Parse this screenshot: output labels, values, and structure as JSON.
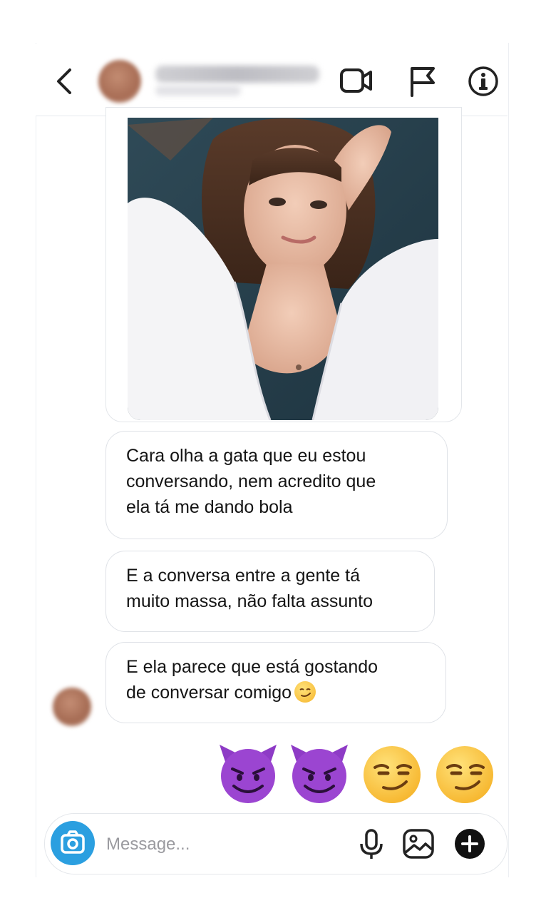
{
  "header": {
    "contact_name": "",
    "icons": [
      "back-icon",
      "video-call-icon",
      "flag-icon",
      "info-icon"
    ]
  },
  "messages": [
    {
      "text": "Cara olha a gata que eu estou\nconversando, nem acredito que\nela tá me dando bola"
    },
    {
      "text": "E a conversa entre a gente tá\nmuito massa, não falta assunto"
    },
    {
      "text": "E ela parece que está gostando\nde conversar comigo",
      "emoji": "smirk-emoji"
    }
  ],
  "reactions": [
    "smiling-devil-emoji",
    "smiling-devil-emoji",
    "smirk-emoji",
    "smirk-emoji"
  ],
  "composer": {
    "placeholder": "Message..."
  },
  "colors": {
    "camera_button": "#2b9fe0",
    "devil_purple": "#8e3bc6",
    "smirk_yellow": "#f6b52c"
  }
}
